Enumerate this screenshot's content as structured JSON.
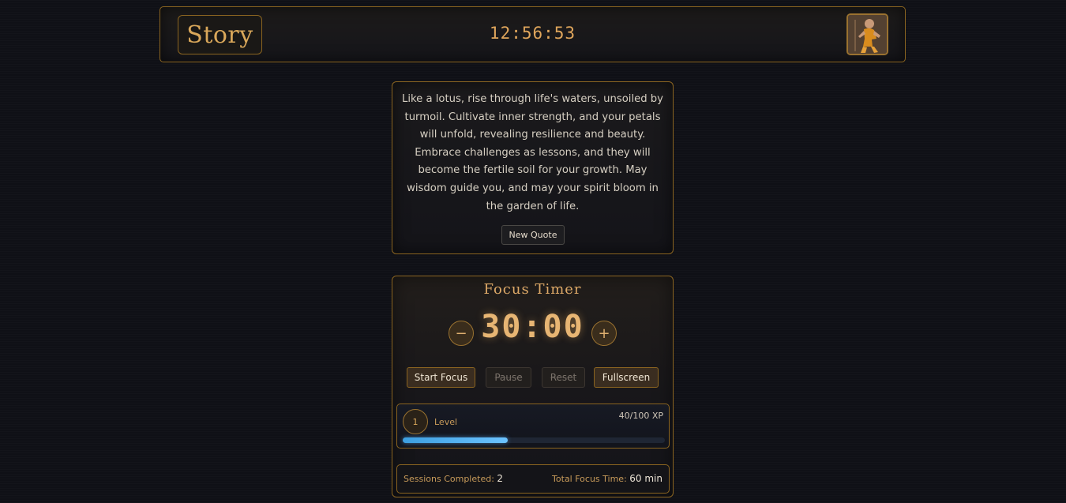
{
  "header": {
    "logo_text": "Story",
    "clock": "12:56:53",
    "avatar_icon": "monk-avatar-icon"
  },
  "quote": {
    "text": "Like a lotus, rise through life's waters, unsoiled by turmoil. Cultivate inner strength, and your petals will unfold, revealing resilience and beauty. Embrace challenges as lessons, and they will become the fertile soil for your growth. May wisdom guide you, and may your spirit bloom in the garden of life.",
    "button_label": "New Quote"
  },
  "timer": {
    "title": "Focus Timer",
    "time": "30:00",
    "decrement_label": "−",
    "increment_label": "+",
    "buttons": {
      "start": "Start Focus",
      "pause": "Pause",
      "reset": "Reset",
      "fullscreen": "Fullscreen"
    }
  },
  "level": {
    "number": "1",
    "label": "Level",
    "xp_text": "40/100 XP",
    "xp_fraction": 0.4
  },
  "stats": {
    "sessions_label": "Sessions Completed:",
    "sessions_value": "2",
    "focus_label": "Total Focus Time:",
    "focus_value": "60 min"
  },
  "colors": {
    "accent_gold": "#d9a75a",
    "border_gold": "#8a6420",
    "xp_blue": "#4fb0f0",
    "background": "#0f1016"
  }
}
